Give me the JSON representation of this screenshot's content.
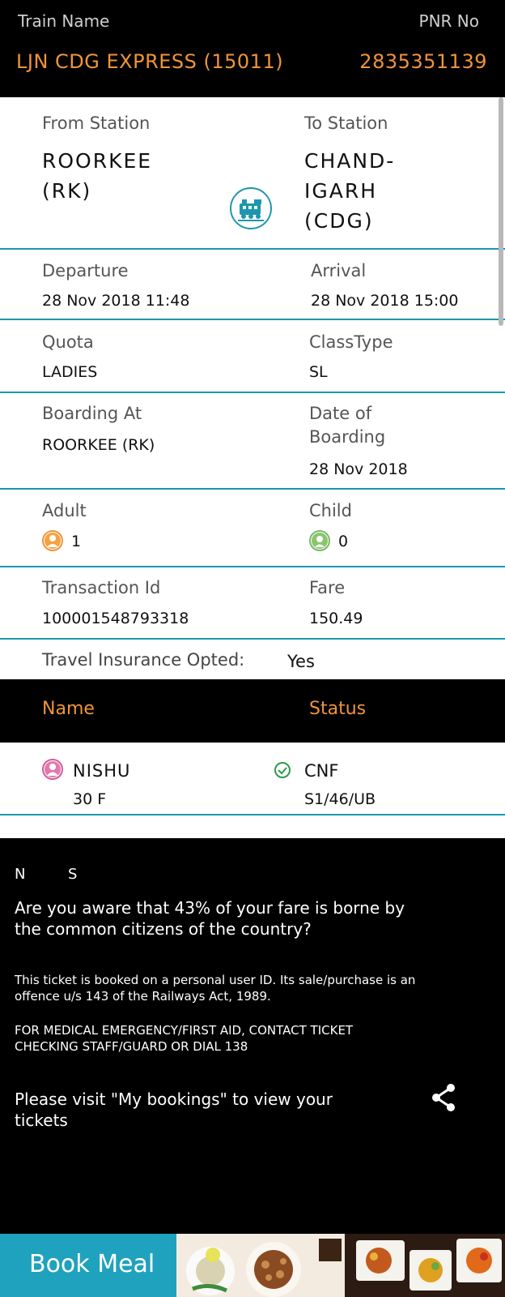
{
  "header": {
    "train_name_label": "Train Name",
    "pnr_label": "PNR No",
    "train_name": "LJN CDG EXPRESS (15011)",
    "pnr_number": "2835351139"
  },
  "journey": {
    "from_label": "From Station",
    "from_line1": "ROORKEE",
    "from_line2": "(RK)",
    "to_label": "To Station",
    "to_line1": "CHAND-",
    "to_line2": "IGARH",
    "to_line3": "(CDG)",
    "icon": "train-icon"
  },
  "departure": {
    "label": "Departure",
    "value": "28 Nov 2018  11:48"
  },
  "arrival": {
    "label": "Arrival",
    "value": "28 Nov 2018  15:00"
  },
  "quota": {
    "label": "Quota",
    "value": "LADIES"
  },
  "class_type": {
    "label": "ClassType",
    "value": "SL"
  },
  "boarding_at": {
    "label": "Boarding At",
    "value": "ROORKEE (RK)"
  },
  "date_of_boarding": {
    "label_line1": "Date of",
    "label_line2": "Boarding",
    "value": "28 Nov 2018"
  },
  "adult": {
    "label": "Adult",
    "value": "1",
    "icon": "adult-icon"
  },
  "child": {
    "label": "Child",
    "value": "0",
    "icon": "child-icon"
  },
  "transaction": {
    "label": "Transaction Id",
    "value": "100001548793318"
  },
  "fare": {
    "label": "Fare",
    "value": "150.49"
  },
  "insurance": {
    "label": "Travel Insurance Opted:",
    "value": "Yes"
  },
  "passengers_header": {
    "name_label": "Name",
    "status_label": "Status"
  },
  "passengers": [
    {
      "name": "NISHU",
      "detail": "30 F",
      "status": "CNF",
      "berth": "S1/46/UB"
    }
  ],
  "notes": {
    "ns_n": "N",
    "ns_s": "S",
    "fare_note_line1": "Are you aware that 43% of your fare is borne by",
    "fare_note_line2": "the common citizens of the country?",
    "personal_id_line1": "This ticket is booked on a personal user ID. Its sale/purchase is an",
    "personal_id_line2": "offence u/s 143 of the Railways Act, 1989.",
    "medical_line1": "FOR MEDICAL EMERGENCY/FIRST AID, CONTACT TICKET",
    "medical_line2": "CHECKING STAFF/GUARD OR DIAL 138",
    "bookings_line1": "Please visit \"My bookings\" to view your",
    "bookings_line2": "tickets"
  },
  "book_meal": {
    "label": "Book Meal"
  },
  "colors": {
    "accent_orange": "#f0943a",
    "teal": "#1d97ad",
    "meal_bar": "#1fa2bd"
  }
}
